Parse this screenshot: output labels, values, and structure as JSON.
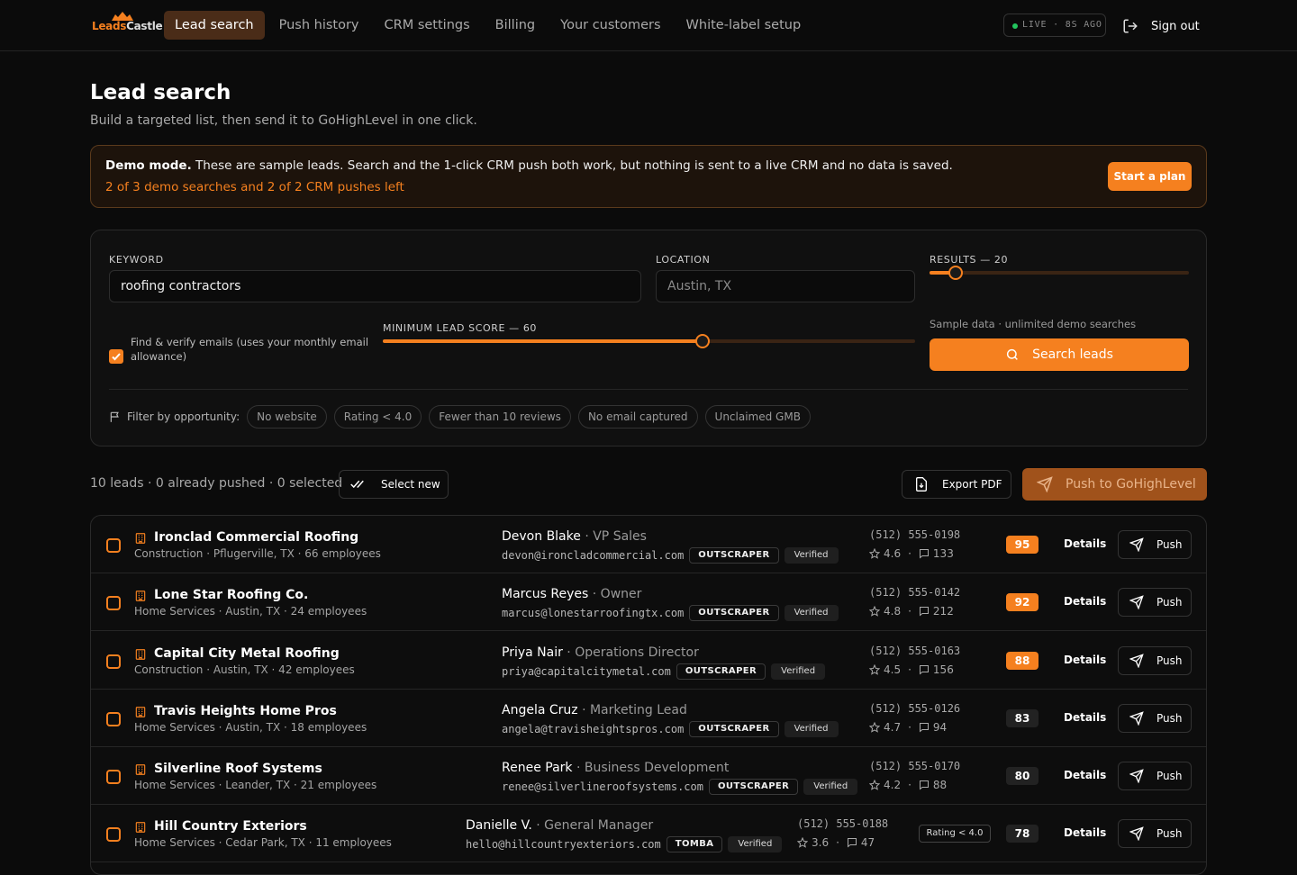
{
  "brand": {
    "name_a": "Leads",
    "name_b": "Castle"
  },
  "nav": {
    "tabs": [
      "Lead search",
      "Push history",
      "CRM settings",
      "Billing",
      "Your customers",
      "White-label setup"
    ],
    "live": "LIVE · 8S AGO",
    "signout": "Sign out"
  },
  "page": {
    "title": "Lead search",
    "subtitle": "Build a targeted list, then send it to GoHighLevel in one click."
  },
  "banner": {
    "bold": "Demo mode.",
    "text": " These are sample leads. Search and the 1-click CRM push both work, but nothing is sent to a live CRM and no data is saved.",
    "remaining": "2 of 3 demo searches and 2 of 2 CRM pushes left",
    "cta": "Start a plan"
  },
  "search": {
    "keyword_label": "KEYWORD",
    "keyword_value": "roofing contractors",
    "location_label": "LOCATION",
    "location_placeholder": "Austin, TX",
    "results_label": "RESULTS — 20",
    "results_value": 20,
    "results_min": 0,
    "results_max": 200,
    "email_check_label": "Find & verify emails (uses your monthly email allowance)",
    "email_checked": true,
    "score_label": "MINIMUM LEAD SCORE — 60",
    "score_value": 60,
    "score_max": 100,
    "sample_note": "Sample data · unlimited demo searches",
    "search_button": "Search leads",
    "filter_label": "Filter by opportunity:",
    "filters": [
      "No website",
      "Rating < 4.0",
      "Fewer than 10 reviews",
      "No email captured",
      "Unclaimed GMB"
    ]
  },
  "toolbar": {
    "count": "10 leads · 0 already pushed · 0 selected",
    "select_new": "Select new",
    "export": "Export PDF",
    "push_all": "Push to GoHighLevel"
  },
  "leads": [
    {
      "company": "Ironclad Commercial Roofing",
      "meta": "Construction · Pflugerville, TX · 66 employees",
      "contact": "Devon Blake",
      "role": " · VP Sales",
      "email": "devon@ironcladcommercial.com",
      "source": "OUTSCRAPER",
      "verified": "Verified",
      "phone": "(512) 555-0198",
      "rating": "4.6",
      "reviews": "133",
      "score": "95",
      "opportunity": "",
      "details": "Details",
      "push": "Push"
    },
    {
      "company": "Lone Star Roofing Co.",
      "meta": "Home Services · Austin, TX · 24 employees",
      "contact": "Marcus Reyes",
      "role": " · Owner",
      "email": "marcus@lonestarroofingtx.com",
      "source": "OUTSCRAPER",
      "verified": "Verified",
      "phone": "(512) 555-0142",
      "rating": "4.8",
      "reviews": "212",
      "score": "92",
      "opportunity": "",
      "details": "Details",
      "push": "Push"
    },
    {
      "company": "Capital City Metal Roofing",
      "meta": "Construction · Austin, TX · 42 employees",
      "contact": "Priya Nair",
      "role": " · Operations Director",
      "email": "priya@capitalcitymetal.com",
      "source": "OUTSCRAPER",
      "verified": "Verified",
      "phone": "(512) 555-0163",
      "rating": "4.5",
      "reviews": "156",
      "score": "88",
      "opportunity": "",
      "details": "Details",
      "push": "Push"
    },
    {
      "company": "Travis Heights Home Pros",
      "meta": "Home Services · Austin, TX · 18 employees",
      "contact": "Angela Cruz",
      "role": " · Marketing Lead",
      "email": "angela@travisheightspros.com",
      "source": "OUTSCRAPER",
      "verified": "Verified",
      "phone": "(512) 555-0126",
      "rating": "4.7",
      "reviews": "94",
      "score": "83",
      "opportunity": "",
      "details": "Details",
      "push": "Push"
    },
    {
      "company": "Silverline Roof Systems",
      "meta": "Home Services · Leander, TX · 21 employees",
      "contact": "Renee Park",
      "role": " · Business Development",
      "email": "renee@silverlineroofsystems.com",
      "source": "OUTSCRAPER",
      "verified": "Verified",
      "phone": "(512) 555-0170",
      "rating": "4.2",
      "reviews": "88",
      "score": "80",
      "opportunity": "",
      "details": "Details",
      "push": "Push"
    },
    {
      "company": "Hill Country Exteriors",
      "meta": "Home Services · Cedar Park, TX · 11 employees",
      "contact": "Danielle V.",
      "role": " · General Manager",
      "email": "hello@hillcountryexteriors.com",
      "source": "TOMBA",
      "verified": "Verified",
      "phone": "(512) 555-0188",
      "rating": "3.6",
      "reviews": "47",
      "score": "78",
      "opportunity": "Rating < 4.0",
      "details": "Details",
      "push": "Push"
    }
  ],
  "colors": {
    "accent": "#f5801f",
    "background": "#0b0b0b",
    "live_dot": "#22c55e"
  }
}
